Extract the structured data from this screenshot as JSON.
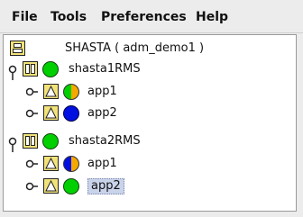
{
  "menubar": {
    "items": [
      "File",
      "Tools",
      "Preferences",
      "Help"
    ]
  },
  "tree": {
    "root": {
      "label": "SHASTA ( adm_demo1 )",
      "icon": "cluster-icon"
    },
    "systems": [
      {
        "label": "shasta1RMS",
        "status": "online",
        "status_color": "#00d000",
        "apps": [
          {
            "label": "app1",
            "status": "partial",
            "status_colors": [
              "#00d000",
              "#f5a800"
            ]
          },
          {
            "label": "app2",
            "status": "offline",
            "status_color": "#0010e0"
          }
        ]
      },
      {
        "label": "shasta2RMS",
        "status": "online",
        "status_color": "#00d000",
        "apps": [
          {
            "label": "app1",
            "status": "partial",
            "status_colors": [
              "#0010e0",
              "#f5a800"
            ]
          },
          {
            "label": "app2",
            "status": "online",
            "status_color": "#00d000",
            "selected": true
          }
        ]
      }
    ]
  },
  "colors": {
    "node_icon_fill": "#f2e27a",
    "online": "#00d000",
    "offline": "#0010e0",
    "warning": "#f5a800"
  }
}
